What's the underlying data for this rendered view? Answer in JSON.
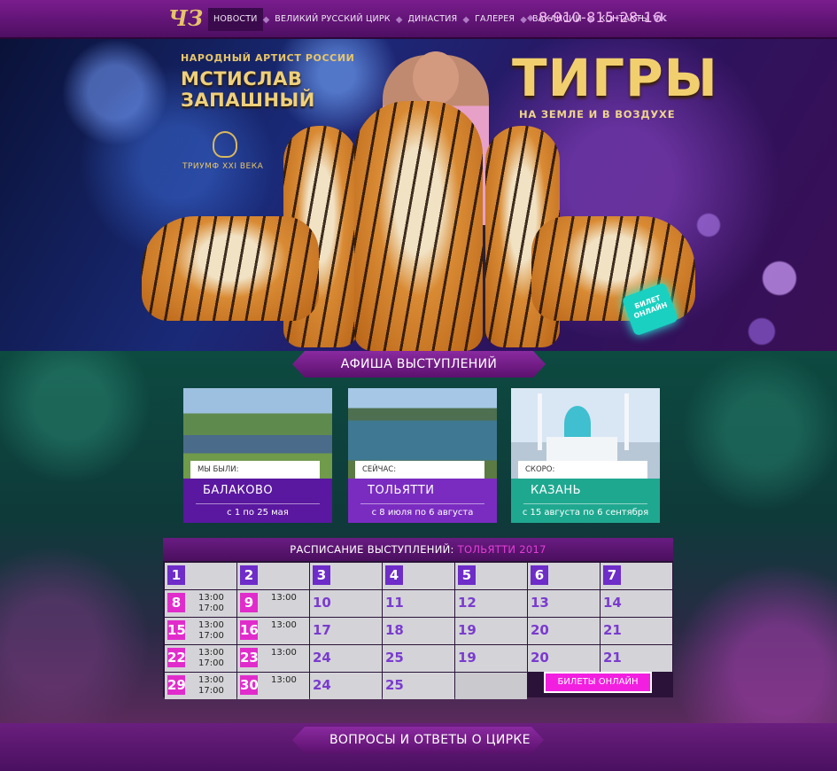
{
  "nav": {
    "items": [
      {
        "label": "Новости",
        "active": true
      },
      {
        "label": "Великий Русский цирк",
        "active": false
      },
      {
        "label": "Династия",
        "active": false
      },
      {
        "label": "Галерея",
        "active": false
      },
      {
        "label": "Вакансии",
        "active": false
      },
      {
        "label": "Контакты",
        "active": false
      }
    ],
    "phone": "8-910-815-28-16",
    "social_icon": "vk-icon",
    "logo_text": "ЧЗ"
  },
  "hero": {
    "subtitle": "Народный артист России",
    "name_line1": "Мстислав",
    "name_line2": "Запашный",
    "emblem_caption": "ТРИУМФ XXI ВЕКА",
    "title": "ТИГРЫ",
    "tagline": "НА ЗЕМЛЕ И В ВОЗДУХЕ",
    "ticket_badge": "БИЛЕТ ОНЛАЙН"
  },
  "afisha": {
    "heading": "Афиша выступлений",
    "cards": [
      {
        "tag": "Мы были:",
        "city": "БАЛАКОВО",
        "dates": "с 1 по 25 мая",
        "color": "#5a17a0"
      },
      {
        "tag": "Сейчас:",
        "city": "ТОЛЬЯТТИ",
        "dates": "с 8 июля по 6 августа",
        "color": "#7a2cc0"
      },
      {
        "tag": "Скоро:",
        "city": "КАЗАНЬ",
        "dates": "с 15 августа по 6 сентября",
        "color": "#1fa890"
      }
    ]
  },
  "schedule": {
    "title": "Расписание выступлений:",
    "highlight": "ТОЛЬЯТТИ 2017",
    "rows": [
      [
        {
          "day": "1",
          "style": "purple"
        },
        {
          "day": "2",
          "style": "purple"
        },
        {
          "day": "3",
          "style": "purple"
        },
        {
          "day": "4",
          "style": "purple"
        },
        {
          "day": "5",
          "style": "purple"
        },
        {
          "day": "6",
          "style": "purple"
        },
        {
          "day": "7",
          "style": "purple"
        }
      ],
      [
        {
          "day": "8",
          "style": "pink",
          "t1": "13:00",
          "t2": "17:00"
        },
        {
          "day": "9",
          "style": "pink",
          "t1": "13:00"
        },
        {
          "day": "10",
          "style": "plain"
        },
        {
          "day": "11",
          "style": "plain"
        },
        {
          "day": "12",
          "style": "plain"
        },
        {
          "day": "13",
          "style": "plain"
        },
        {
          "day": "14",
          "style": "plain"
        }
      ],
      [
        {
          "day": "15",
          "style": "pink",
          "t1": "13:00",
          "t2": "17:00"
        },
        {
          "day": "16",
          "style": "pink",
          "t1": "13:00"
        },
        {
          "day": "17",
          "style": "plain"
        },
        {
          "day": "18",
          "style": "plain"
        },
        {
          "day": "19",
          "style": "plain"
        },
        {
          "day": "20",
          "style": "plain"
        },
        {
          "day": "21",
          "style": "plain"
        }
      ],
      [
        {
          "day": "22",
          "style": "pink",
          "t1": "13:00",
          "t2": "17:00"
        },
        {
          "day": "23",
          "style": "pink",
          "t1": "13:00"
        },
        {
          "day": "24",
          "style": "plain"
        },
        {
          "day": "25",
          "style": "plain"
        },
        {
          "day": "19",
          "style": "plain"
        },
        {
          "day": "20",
          "style": "plain"
        },
        {
          "day": "21",
          "style": "plain"
        }
      ],
      [
        {
          "day": "29",
          "style": "pink",
          "t1": "13:00",
          "t2": "17:00"
        },
        {
          "day": "30",
          "style": "pink",
          "t1": "13:00"
        },
        {
          "day": "24",
          "style": "plain"
        },
        {
          "day": "25",
          "style": "plain"
        },
        {
          "day": "",
          "style": "empty"
        }
      ]
    ],
    "buy_label": "Билеты онлайн"
  },
  "faq": {
    "heading": "Вопросы и ответы о цирке"
  }
}
